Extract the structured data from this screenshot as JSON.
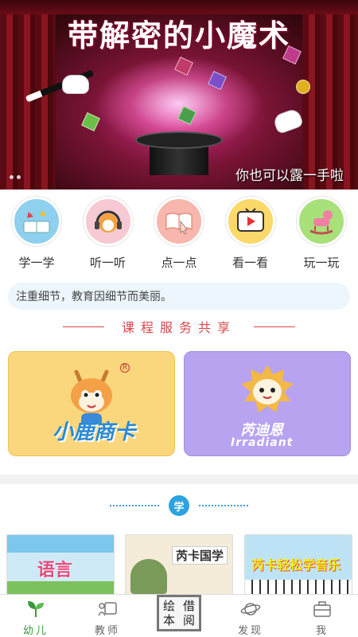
{
  "banner": {
    "title": "带解密的小魔术",
    "subtitle": "你也可以露一手啦"
  },
  "categories": [
    {
      "label": "学一学",
      "icon": "book-butterfly-icon",
      "color": "#8fd0ef"
    },
    {
      "label": "听一听",
      "icon": "headphones-mascot-icon",
      "color": "#f7c9d2"
    },
    {
      "label": "点一点",
      "icon": "pointing-book-icon",
      "color": "#f7b7ad"
    },
    {
      "label": "看一看",
      "icon": "video-tv-icon",
      "color": "#fbd86a"
    },
    {
      "label": "玩一玩",
      "icon": "rocking-horse-icon",
      "color": "#a8e07a"
    }
  ],
  "tip": "注重细节，教育因细节而美丽。",
  "section": {
    "title": "课程服务共享"
  },
  "cards": [
    {
      "brand": "小鹿商卡",
      "bg": "#fad77c"
    },
    {
      "brand": "芮迪恩",
      "brand_en": "Irradiant",
      "bg": "#b7a3f0"
    }
  ],
  "books_section": {
    "badge": "学"
  },
  "books": [
    {
      "title": "语言",
      "bg": "#cfeaf7"
    },
    {
      "title": "芮卡国学",
      "bg": "#f4ecd8"
    },
    {
      "title": "芮卡轻松学音乐",
      "bg": "#bfe3f6"
    }
  ],
  "tabs": [
    {
      "label": "幼儿",
      "icon": "sprout-icon",
      "active": true
    },
    {
      "label": "教师",
      "icon": "teacher-icon",
      "active": false
    },
    {
      "label": "绘本借阅",
      "icon": "",
      "active": false
    },
    {
      "label": "发现",
      "icon": "planet-icon",
      "active": false
    },
    {
      "label": "我",
      "icon": "briefcase-icon",
      "active": false
    }
  ]
}
